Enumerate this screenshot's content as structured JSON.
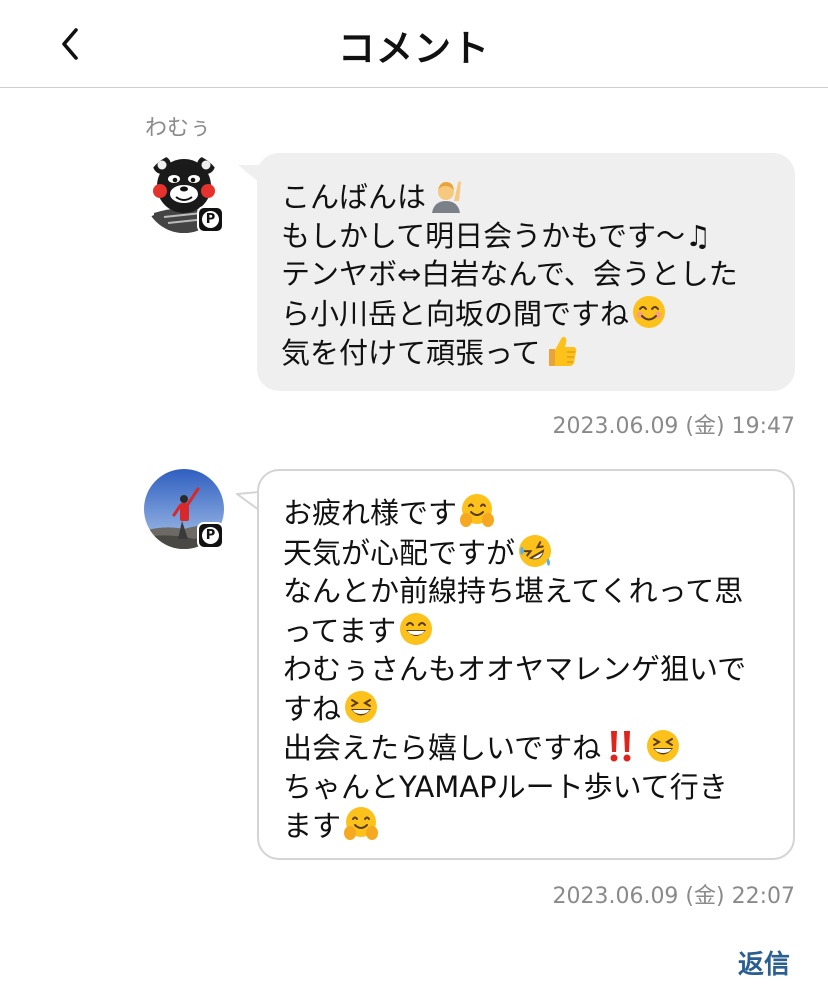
{
  "header": {
    "back_icon": "chevron-left-icon",
    "title": "コメント"
  },
  "comments": [
    {
      "username": "わむぅ",
      "premium_badge": "P",
      "lines": [
        "こんばんは",
        "もしかして明日会うかもです〜♫",
        "テンヤボ⇔白岩なんで、会うとした",
        "ら小川岳と向坂の間ですね",
        "気を付けて頑張って"
      ],
      "emojis": [
        "person-raising-hand-emoji",
        "smiling-face-emoji",
        "thumbs-up-emoji"
      ],
      "timestamp": "2023.06.09 (金) 19:47"
    },
    {
      "username": "",
      "premium_badge": "P",
      "lines": [
        "お疲れ様です",
        "天気が心配ですが",
        "なんとか前線持ち堪えてくれって思",
        "ってます",
        "わむぅさんもオオヤマレンゲ狙いで",
        "すね",
        "出会えたら嬉しいですね",
        "ちゃんとYAMAPルート歩いて行き",
        "ます"
      ],
      "emojis": [
        "hugging-face-emoji",
        "rolling-laughing-emoji",
        "grinning-face-emoji",
        "laughing-face-emoji",
        "double-exclamation-emoji",
        "laughing-face-emoji",
        "hugging-face-emoji"
      ],
      "timestamp": "2023.06.09 (金) 22:07"
    }
  ],
  "reply_label": "返信",
  "colors": {
    "reply": "#2b5f92",
    "gray_bubble": "#efefef",
    "meta_text": "#8a8a8a"
  }
}
